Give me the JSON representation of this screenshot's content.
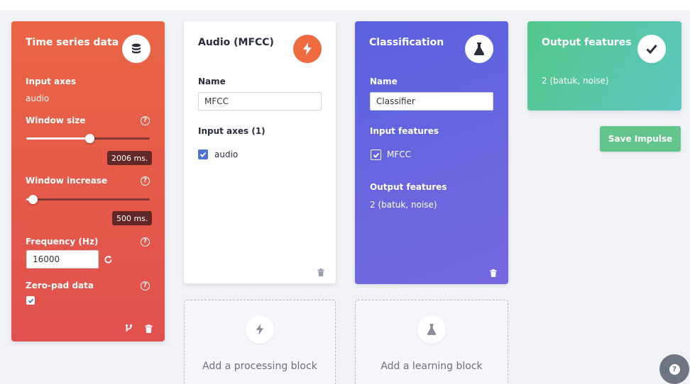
{
  "time_series": {
    "title": "Time series data",
    "icon": "database-icon",
    "input_axes_label": "Input axes",
    "input_axes_value": "audio",
    "window_size_label": "Window size",
    "window_size_value": "2006 ms.",
    "window_size_fraction": 0.51,
    "window_increase_label": "Window increase",
    "window_increase_value": "500 ms.",
    "window_increase_fraction": 0.05,
    "frequency_label": "Frequency (Hz)",
    "frequency_value": "16000",
    "zero_pad_label": "Zero-pad data",
    "zero_pad_checked": true,
    "help_glyph": "?"
  },
  "audio_block": {
    "title": "Audio (MFCC)",
    "icon": "lightning-icon",
    "name_label": "Name",
    "name_value": "MFCC",
    "input_axes_label": "Input axes (1)",
    "axis_item": "audio",
    "axis_checked": true
  },
  "classification_block": {
    "title": "Classification",
    "icon": "flask-icon",
    "name_label": "Name",
    "name_value": "Classifier",
    "input_features_label": "Input features",
    "input_feature_item": "MFCC",
    "output_features_label": "Output features",
    "output_features_value": "2 (batuk, noise)"
  },
  "output_block": {
    "title": "Output features",
    "icon": "checkmark-icon",
    "value": "2 (batuk, noise)"
  },
  "save_button": "Save Impulse",
  "add_processing": "Add a processing block",
  "add_learning": "Add a learning block",
  "help_button": "?",
  "colors": {
    "time_series": "#e65a48",
    "audio_accent": "#ef6a3e",
    "classification": "#6565e0",
    "output": "#55c8a0",
    "save": "#63c58a"
  }
}
